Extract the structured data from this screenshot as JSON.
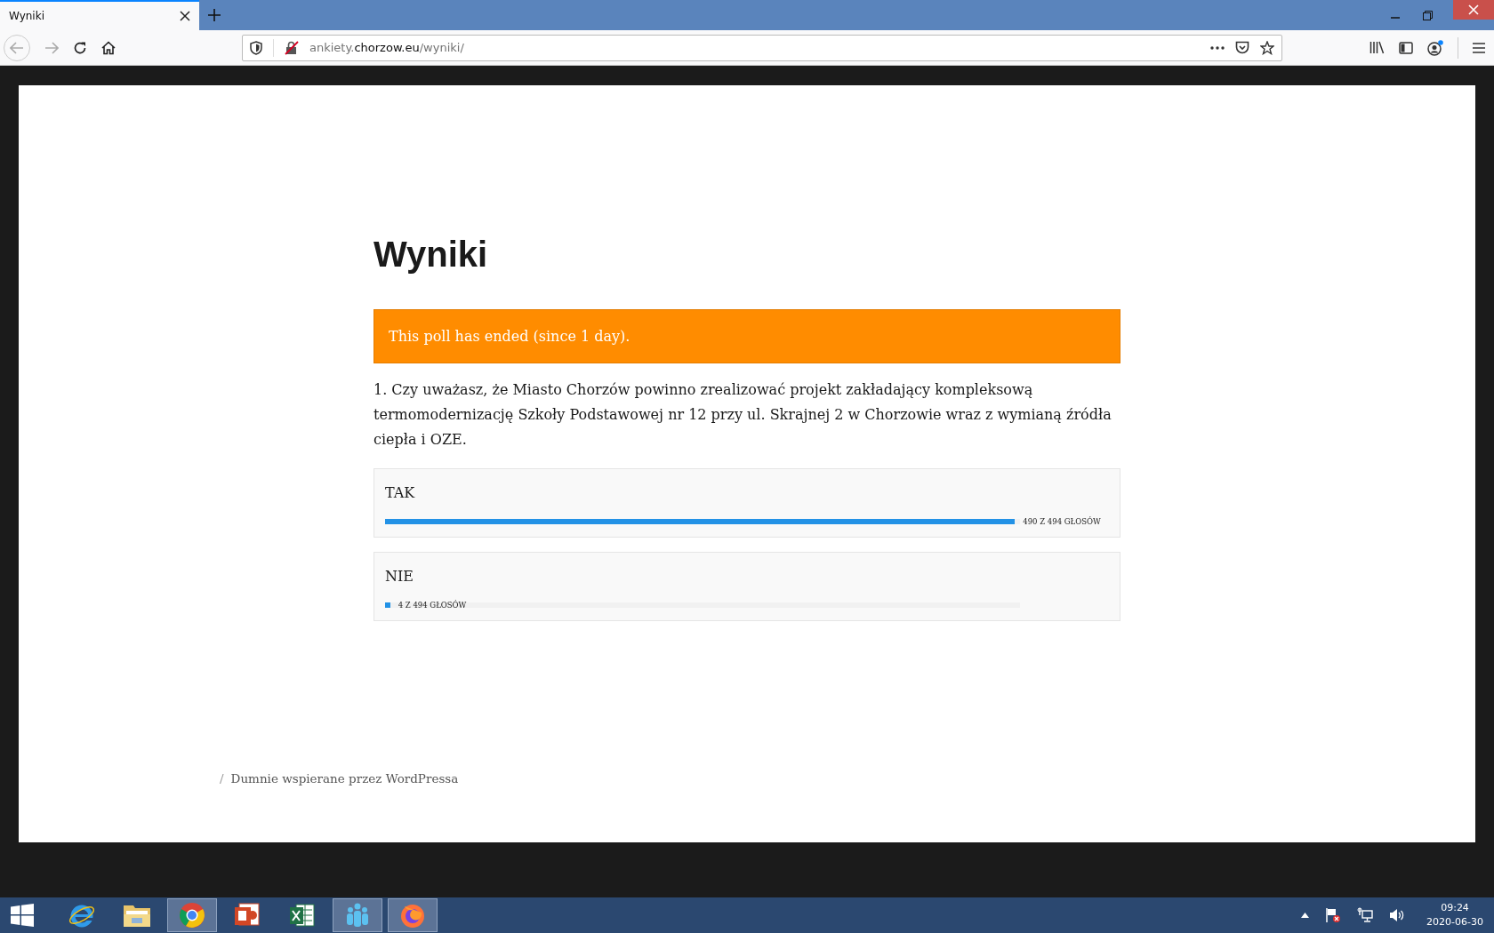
{
  "browser": {
    "tabs": [
      {
        "title": "Wyniki",
        "selected": true
      }
    ],
    "url": {
      "prefix": "ankiety.",
      "domain": "chorzow.eu",
      "path": "/wyniki/"
    }
  },
  "page": {
    "title": "Wyniki",
    "notice": "This poll has ended (since 1 day).",
    "question": "1. Czy uważasz, że Miasto Chorzów powinno zrealizować projekt zakładający kompleksową termomodernizację Szkoły Podstawowej nr 12 przy ul. Skrajnej 2 w Chorzowie wraz z wymianą źródła ciepła i OZE.",
    "answers": [
      {
        "label": "TAK",
        "level": 0.992,
        "votes": "490 Z 494 GŁOSÓW"
      },
      {
        "label": "NIE",
        "level": 0.008,
        "votes": "4 Z 494 GŁOSÓW"
      }
    ],
    "footer": {
      "separator": "/",
      "credit": "Dumnie wspierane przez WordPressa"
    }
  },
  "taskbar": {
    "apps": [
      {
        "kind": "ie",
        "selected": false
      },
      {
        "kind": "explorer",
        "selected": false
      },
      {
        "kind": "chrome",
        "selected": true
      },
      {
        "kind": "powerpoint",
        "selected": false
      },
      {
        "kind": "excel",
        "selected": false
      },
      {
        "kind": "people",
        "selected": true
      },
      {
        "kind": "firefox",
        "selected": true
      }
    ],
    "time": "09:24",
    "date": "2020-06-30"
  }
}
